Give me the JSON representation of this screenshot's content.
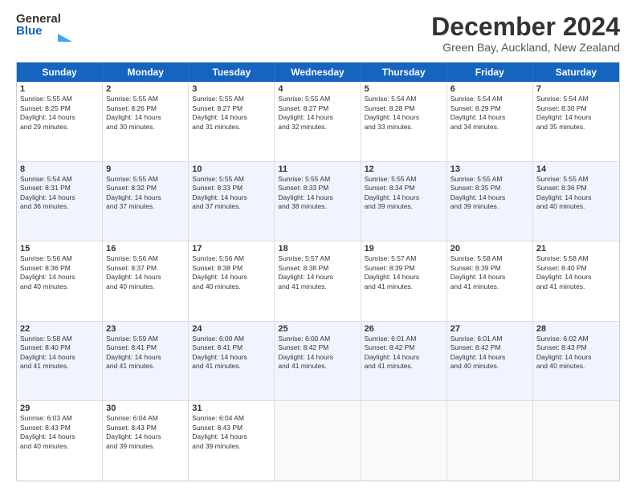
{
  "header": {
    "logo_general": "General",
    "logo_blue": "Blue",
    "main_title": "December 2024",
    "subtitle": "Green Bay, Auckland, New Zealand"
  },
  "calendar": {
    "days_of_week": [
      "Sunday",
      "Monday",
      "Tuesday",
      "Wednesday",
      "Thursday",
      "Friday",
      "Saturday"
    ],
    "rows": [
      {
        "cells": [
          {
            "day": "1",
            "info": "Sunrise: 5:55 AM\nSunset: 8:25 PM\nDaylight: 14 hours\nand 29 minutes."
          },
          {
            "day": "2",
            "info": "Sunrise: 5:55 AM\nSunset: 8:26 PM\nDaylight: 14 hours\nand 30 minutes."
          },
          {
            "day": "3",
            "info": "Sunrise: 5:55 AM\nSunset: 8:27 PM\nDaylight: 14 hours\nand 31 minutes."
          },
          {
            "day": "4",
            "info": "Sunrise: 5:55 AM\nSunset: 8:27 PM\nDaylight: 14 hours\nand 32 minutes."
          },
          {
            "day": "5",
            "info": "Sunrise: 5:54 AM\nSunset: 8:28 PM\nDaylight: 14 hours\nand 33 minutes."
          },
          {
            "day": "6",
            "info": "Sunrise: 5:54 AM\nSunset: 8:29 PM\nDaylight: 14 hours\nand 34 minutes."
          },
          {
            "day": "7",
            "info": "Sunrise: 5:54 AM\nSunset: 8:30 PM\nDaylight: 14 hours\nand 35 minutes."
          }
        ]
      },
      {
        "cells": [
          {
            "day": "8",
            "info": "Sunrise: 5:54 AM\nSunset: 8:31 PM\nDaylight: 14 hours\nand 36 minutes."
          },
          {
            "day": "9",
            "info": "Sunrise: 5:55 AM\nSunset: 8:32 PM\nDaylight: 14 hours\nand 37 minutes."
          },
          {
            "day": "10",
            "info": "Sunrise: 5:55 AM\nSunset: 8:33 PM\nDaylight: 14 hours\nand 37 minutes."
          },
          {
            "day": "11",
            "info": "Sunrise: 5:55 AM\nSunset: 8:33 PM\nDaylight: 14 hours\nand 38 minutes."
          },
          {
            "day": "12",
            "info": "Sunrise: 5:55 AM\nSunset: 8:34 PM\nDaylight: 14 hours\nand 39 minutes."
          },
          {
            "day": "13",
            "info": "Sunrise: 5:55 AM\nSunset: 8:35 PM\nDaylight: 14 hours\nand 39 minutes."
          },
          {
            "day": "14",
            "info": "Sunrise: 5:55 AM\nSunset: 8:36 PM\nDaylight: 14 hours\nand 40 minutes."
          }
        ]
      },
      {
        "cells": [
          {
            "day": "15",
            "info": "Sunrise: 5:56 AM\nSunset: 8:36 PM\nDaylight: 14 hours\nand 40 minutes."
          },
          {
            "day": "16",
            "info": "Sunrise: 5:56 AM\nSunset: 8:37 PM\nDaylight: 14 hours\nand 40 minutes."
          },
          {
            "day": "17",
            "info": "Sunrise: 5:56 AM\nSunset: 8:38 PM\nDaylight: 14 hours\nand 40 minutes."
          },
          {
            "day": "18",
            "info": "Sunrise: 5:57 AM\nSunset: 8:38 PM\nDaylight: 14 hours\nand 41 minutes."
          },
          {
            "day": "19",
            "info": "Sunrise: 5:57 AM\nSunset: 8:39 PM\nDaylight: 14 hours\nand 41 minutes."
          },
          {
            "day": "20",
            "info": "Sunrise: 5:58 AM\nSunset: 8:39 PM\nDaylight: 14 hours\nand 41 minutes."
          },
          {
            "day": "21",
            "info": "Sunrise: 5:58 AM\nSunset: 8:40 PM\nDaylight: 14 hours\nand 41 minutes."
          }
        ]
      },
      {
        "cells": [
          {
            "day": "22",
            "info": "Sunrise: 5:58 AM\nSunset: 8:40 PM\nDaylight: 14 hours\nand 41 minutes."
          },
          {
            "day": "23",
            "info": "Sunrise: 5:59 AM\nSunset: 8:41 PM\nDaylight: 14 hours\nand 41 minutes."
          },
          {
            "day": "24",
            "info": "Sunrise: 6:00 AM\nSunset: 8:41 PM\nDaylight: 14 hours\nand 41 minutes."
          },
          {
            "day": "25",
            "info": "Sunrise: 6:00 AM\nSunset: 8:42 PM\nDaylight: 14 hours\nand 41 minutes."
          },
          {
            "day": "26",
            "info": "Sunrise: 6:01 AM\nSunset: 8:42 PM\nDaylight: 14 hours\nand 41 minutes."
          },
          {
            "day": "27",
            "info": "Sunrise: 6:01 AM\nSunset: 8:42 PM\nDaylight: 14 hours\nand 40 minutes."
          },
          {
            "day": "28",
            "info": "Sunrise: 6:02 AM\nSunset: 8:43 PM\nDaylight: 14 hours\nand 40 minutes."
          }
        ]
      },
      {
        "cells": [
          {
            "day": "29",
            "info": "Sunrise: 6:03 AM\nSunset: 8:43 PM\nDaylight: 14 hours\nand 40 minutes."
          },
          {
            "day": "30",
            "info": "Sunrise: 6:04 AM\nSunset: 8:43 PM\nDaylight: 14 hours\nand 39 minutes."
          },
          {
            "day": "31",
            "info": "Sunrise: 6:04 AM\nSunset: 8:43 PM\nDaylight: 14 hours\nand 39 minutes."
          },
          {
            "day": "",
            "info": ""
          },
          {
            "day": "",
            "info": ""
          },
          {
            "day": "",
            "info": ""
          },
          {
            "day": "",
            "info": ""
          }
        ]
      }
    ]
  }
}
